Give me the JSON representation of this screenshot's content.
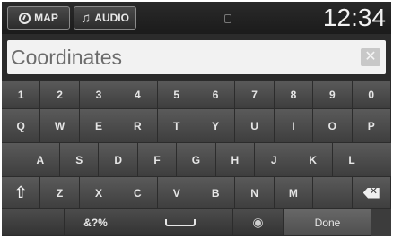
{
  "status_bar": {
    "map_label": "MAP",
    "audio_label": "AUDIO",
    "time": "12:34",
    "icons": [
      "compass-icon",
      "music-note-icon"
    ]
  },
  "search": {
    "value": "Coordinates",
    "clear_icon": "clear-icon"
  },
  "keyboard": {
    "number_row": [
      "1",
      "2",
      "3",
      "4",
      "5",
      "6",
      "7",
      "8",
      "9",
      "0"
    ],
    "row1": [
      "Q",
      "W",
      "E",
      "R",
      "T",
      "Y",
      "U",
      "I",
      "O",
      "P"
    ],
    "row2": [
      "A",
      "S",
      "D",
      "F",
      "G",
      "H",
      "J",
      "K",
      "L"
    ],
    "row3": [
      "Z",
      "X",
      "C",
      "V",
      "B",
      "N",
      "M"
    ],
    "symbols_label": "&?%",
    "done_label": "Done",
    "icons": [
      "shift-icon",
      "backspace-icon",
      "space-icon",
      "voice-icon"
    ]
  },
  "colors": {
    "background": "#3c3c3c",
    "input_background": "#f2f2f2",
    "key_text": "#e6e6e6"
  }
}
